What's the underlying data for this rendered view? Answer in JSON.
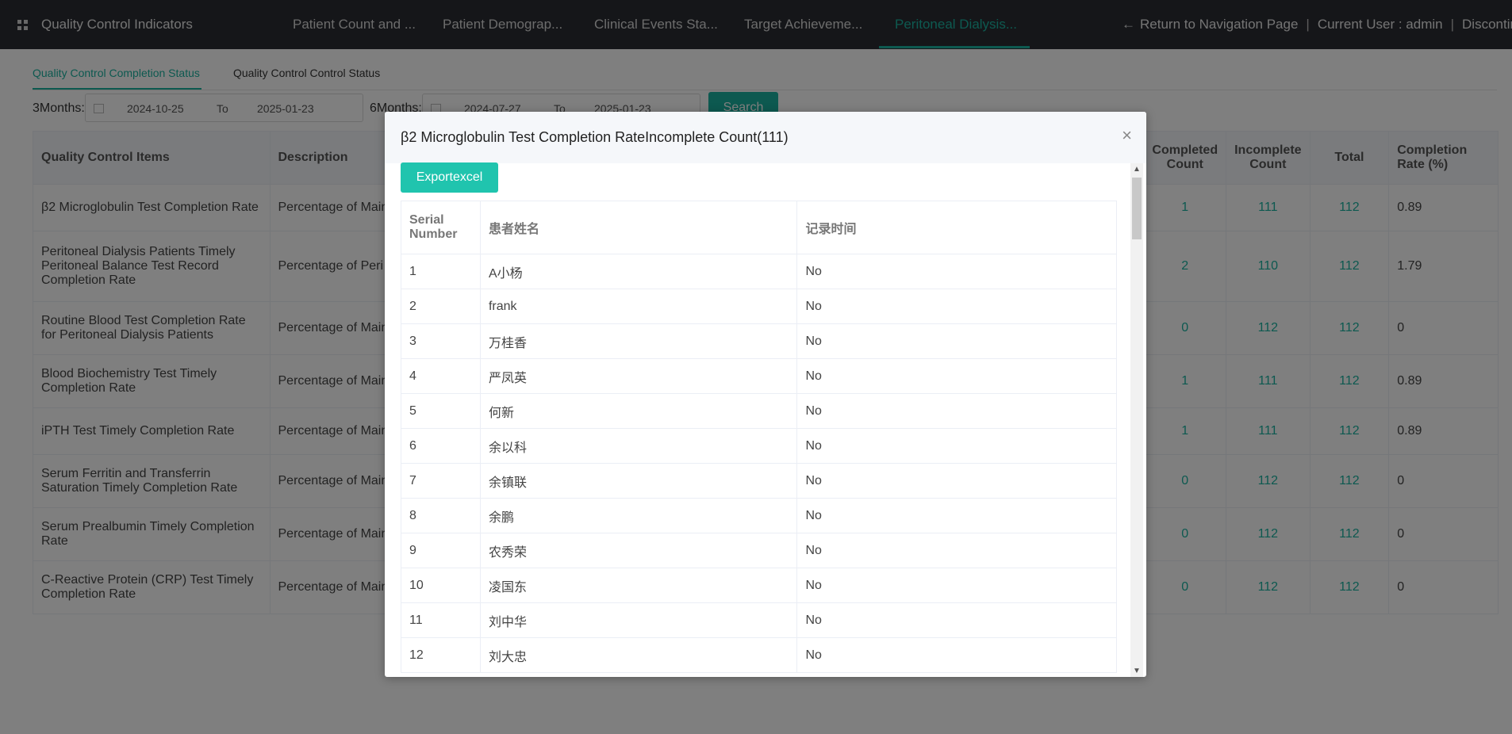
{
  "app": {
    "title": "Quality Control Indicators",
    "nav_tabs": [
      {
        "label": "Patient Count and ...",
        "active": false
      },
      {
        "label": "Patient Demograp...",
        "active": false
      },
      {
        "label": "Clinical Events Sta...",
        "active": false
      },
      {
        "label": "Target Achieveme...",
        "active": false
      },
      {
        "label": "Peritoneal Dialysis...",
        "active": true
      }
    ],
    "return_link": "Return to Navigation Page",
    "current_user": "Current User : admin",
    "discontinued": "Discontinued"
  },
  "subtabs": [
    {
      "label": "Quality Control Completion Status",
      "active": true
    },
    {
      "label": "Quality Control Control Status",
      "active": false
    }
  ],
  "filters": {
    "three_months_label": "3Months:",
    "three_from": "2024-10-25",
    "three_to": "2025-01-23",
    "six_months_label": "6Months:",
    "six_from": "2024-07-27",
    "six_to": "2025-01-23",
    "to_label": "To",
    "search_label": "Search"
  },
  "main_table": {
    "headers": {
      "item": "Quality Control Items",
      "description": "Description",
      "completed": "Completed Count",
      "incomplete": "Incomplete Count",
      "total": "Total",
      "rate": "Completion Rate (%)"
    },
    "rows": [
      {
        "item": "β2 Microglobulin Test Completion Rate",
        "desc": "Percentage of Main",
        "completed": "1",
        "incomplete": "111",
        "total": "112",
        "rate": "0.89"
      },
      {
        "item": "Peritoneal Dialysis Patients Timely Peritoneal Balance Test Record Completion Rate",
        "desc": "Percentage of Peri",
        "completed": "2",
        "incomplete": "110",
        "total": "112",
        "rate": "1.79"
      },
      {
        "item": "Routine Blood Test Completion Rate for Peritoneal Dialysis Patients",
        "desc": "Percentage of Main",
        "completed": "0",
        "incomplete": "112",
        "total": "112",
        "rate": "0"
      },
      {
        "item": "Blood Biochemistry Test Timely Completion Rate",
        "desc": "Percentage of Main",
        "completed": "1",
        "incomplete": "111",
        "total": "112",
        "rate": "0.89"
      },
      {
        "item": "iPTH Test Timely Completion Rate",
        "desc": "Percentage of Main",
        "completed": "1",
        "incomplete": "111",
        "total": "112",
        "rate": "0.89"
      },
      {
        "item": "Serum Ferritin and Transferrin Saturation Timely Completion Rate",
        "desc": "Percentage of Main",
        "completed": "0",
        "incomplete": "112",
        "total": "112",
        "rate": "0"
      },
      {
        "item": "Serum Prealbumin Timely Completion Rate",
        "desc": "Percentage of Main",
        "completed": "0",
        "incomplete": "112",
        "total": "112",
        "rate": "0"
      },
      {
        "item": "C-Reactive Protein (CRP) Test Timely Completion Rate",
        "desc": "Percentage of Main",
        "completed": "0",
        "incomplete": "112",
        "total": "112",
        "rate": "0"
      }
    ]
  },
  "modal": {
    "title": "β2 Microglobulin Test Completion RateIncomplete Count(111)",
    "close": "×",
    "export_label": "Exportexcel",
    "headers": {
      "serial": "Serial Number",
      "name": "患者姓名",
      "time": "记录时间"
    },
    "rows": [
      {
        "serial": "1",
        "name": "A小杨",
        "time": "No"
      },
      {
        "serial": "2",
        "name": "frank",
        "time": "No"
      },
      {
        "serial": "3",
        "name": "万桂香",
        "time": "No"
      },
      {
        "serial": "4",
        "name": "严凤英",
        "time": "No"
      },
      {
        "serial": "5",
        "name": "何新",
        "time": "No"
      },
      {
        "serial": "6",
        "name": "余以科",
        "time": "No"
      },
      {
        "serial": "7",
        "name": "余镇联",
        "time": "No"
      },
      {
        "serial": "8",
        "name": "余鹏",
        "time": "No"
      },
      {
        "serial": "9",
        "name": "农秀荣",
        "time": "No"
      },
      {
        "serial": "10",
        "name": "凌国东",
        "time": "No"
      },
      {
        "serial": "11",
        "name": "刘中华",
        "time": "No"
      },
      {
        "serial": "12",
        "name": "刘大忠",
        "time": "No"
      }
    ]
  }
}
